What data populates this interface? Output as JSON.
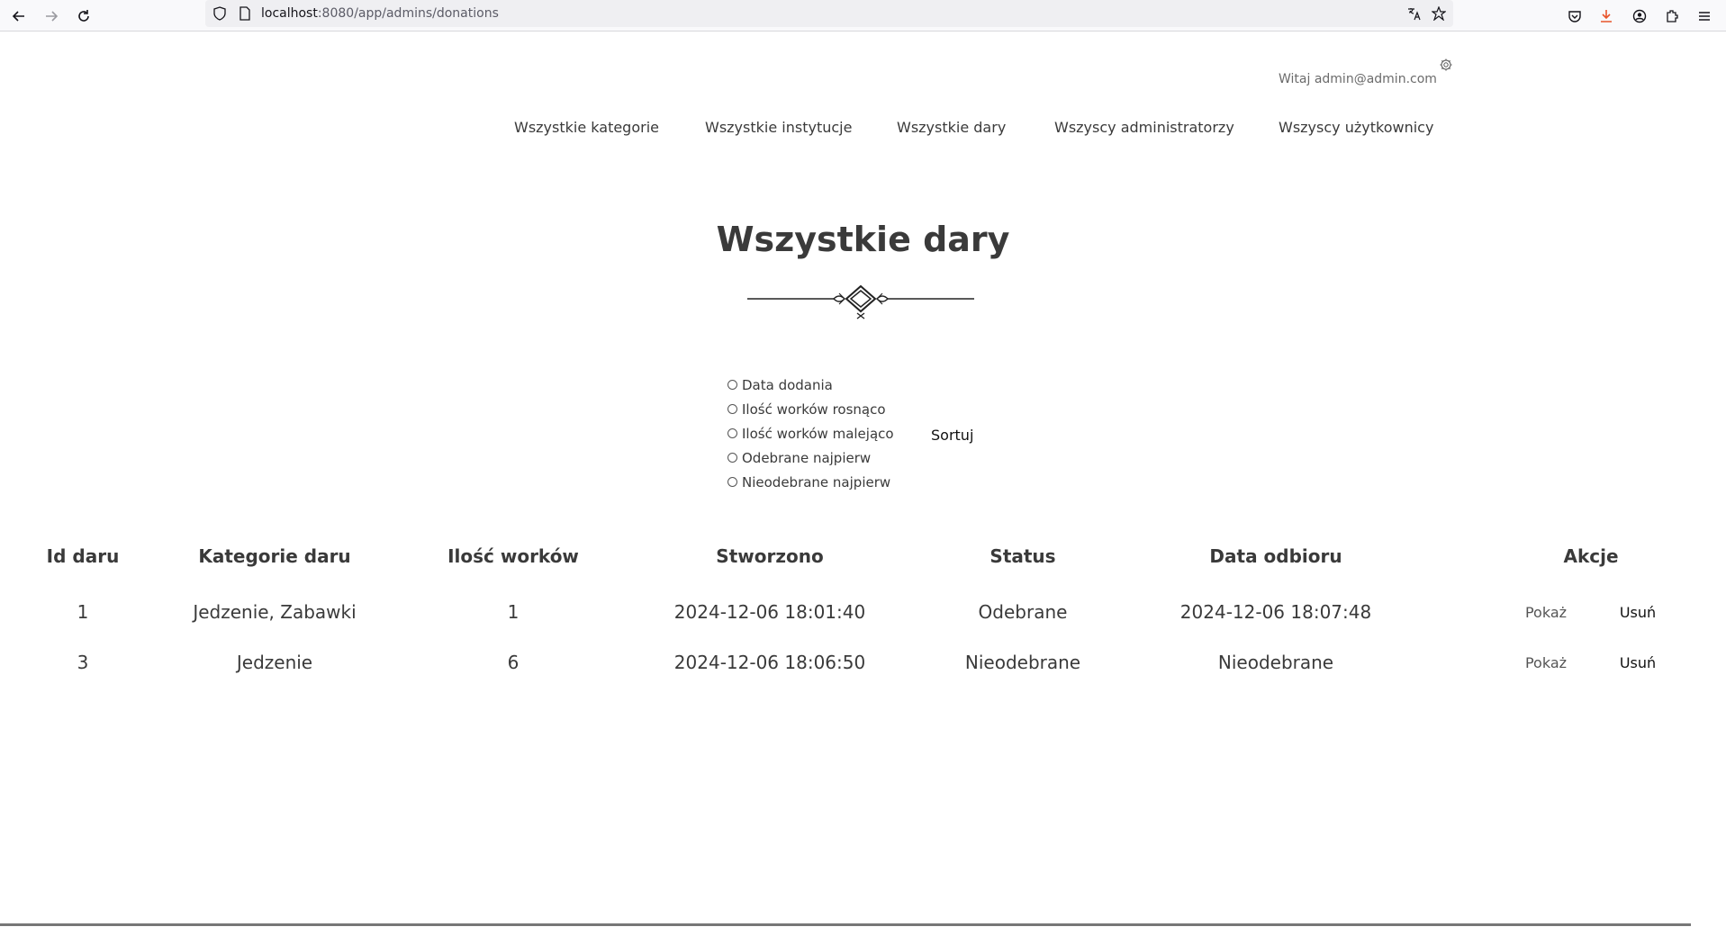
{
  "browser": {
    "url_host": "localhost",
    "url_path": ":8080/app/admins/donations",
    "icons": [
      "back-arrow-icon",
      "forward-arrow-icon",
      "reload-icon",
      "shield-icon",
      "page-icon",
      "translate-icon",
      "bookmark-star-icon",
      "pocket-icon",
      "download-icon",
      "account-icon",
      "extensions-icon",
      "menu-icon"
    ]
  },
  "header": {
    "greeting": "Witaj admin@admin.com",
    "settings_icon": "gear-icon"
  },
  "nav": {
    "items": [
      {
        "label": "Wszystkie kategorie"
      },
      {
        "label": "Wszystkie instytucje"
      },
      {
        "label": "Wszystkie dary"
      },
      {
        "label": "Wszyscy administratorzy"
      },
      {
        "label": "Wszyscy użytkownicy"
      }
    ]
  },
  "main": {
    "title": "Wszystkie dary",
    "sort": {
      "options": [
        {
          "label": "Data dodania"
        },
        {
          "label": "Ilość worków rosnąco"
        },
        {
          "label": "Ilość worków malejąco"
        },
        {
          "label": "Odebrane najpierw"
        },
        {
          "label": "Nieodebrane najpierw"
        }
      ],
      "button_label": "Sortuj"
    },
    "table": {
      "headers": [
        "Id daru",
        "Kategorie daru",
        "Ilość worków",
        "Stworzono",
        "Status",
        "Data odbioru",
        "Akcje"
      ],
      "rows": [
        {
          "id": "1",
          "categories": "Jedzenie, Zabawki",
          "bags": "1",
          "created": "2024-12-06 18:01:40",
          "status": "Odebrane",
          "pickup": "2024-12-06 18:07:48",
          "show": "Pokaż",
          "delete": "Usuń"
        },
        {
          "id": "3",
          "categories": "Jedzenie",
          "bags": "6",
          "created": "2024-12-06 18:06:50",
          "status": "Nieodebrane",
          "pickup": "Nieodebrane",
          "show": "Pokaż",
          "delete": "Usuń"
        }
      ]
    }
  }
}
